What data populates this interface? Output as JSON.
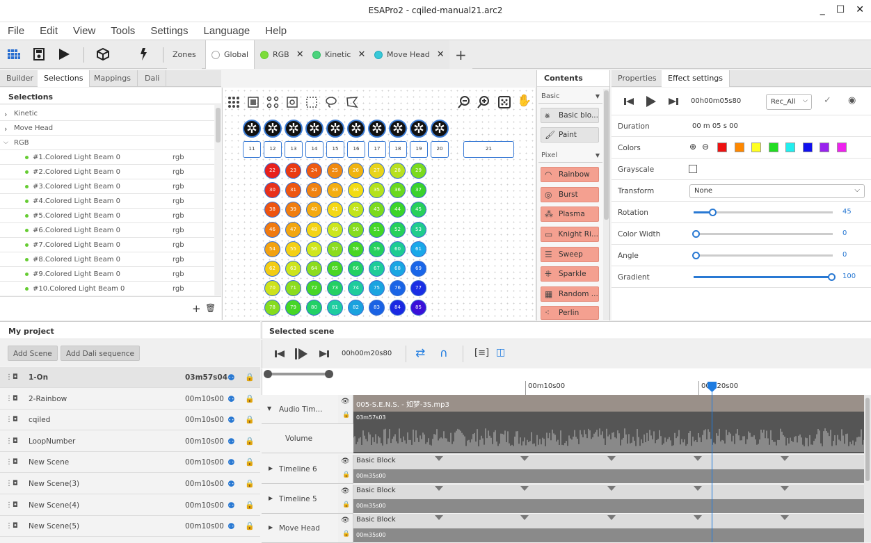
{
  "window": {
    "title": "ESAPro2 - cqiled-manual21.arc2"
  },
  "menu": [
    "File",
    "Edit",
    "View",
    "Tools",
    "Settings",
    "Language",
    "Help"
  ],
  "toolbar": {
    "zones_label": "Zones",
    "tabs": [
      {
        "label": "Global",
        "color": "#ffffff"
      },
      {
        "label": "RGB",
        "color": "#7ddc3a"
      },
      {
        "label": "Kinetic",
        "color": "#4bd37c"
      },
      {
        "label": "Move Head",
        "color": "#38c9d8"
      }
    ]
  },
  "left_tabs": [
    "Builder",
    "Selections",
    "Mappings",
    "Dali"
  ],
  "selections": {
    "header": "Selections",
    "groups": [
      "Kinetic",
      "Move Head",
      "RGB"
    ],
    "items": [
      {
        "name": "#1.Colored Light Beam 0",
        "type": "rgb"
      },
      {
        "name": "#2.Colored Light Beam 0",
        "type": "rgb"
      },
      {
        "name": "#3.Colored Light Beam 0",
        "type": "rgb"
      },
      {
        "name": "#4.Colored Light Beam 0",
        "type": "rgb"
      },
      {
        "name": "#5.Colored Light Beam 0",
        "type": "rgb"
      },
      {
        "name": "#6.Colored Light Beam 0",
        "type": "rgb"
      },
      {
        "name": "#7.Colored Light Beam 0",
        "type": "rgb"
      },
      {
        "name": "#8.Colored Light Beam 0",
        "type": "rgb"
      },
      {
        "name": "#9.Colored Light Beam 0",
        "type": "rgb"
      },
      {
        "name": "#10.Colored Light Beam 0",
        "type": "rgb"
      }
    ]
  },
  "canvas": {
    "square_labels": [
      "11",
      "12",
      "13",
      "14",
      "15",
      "16",
      "17",
      "18",
      "19",
      "20",
      "21"
    ],
    "led_rows": [
      {
        "labels": [
          "22",
          "23",
          "24",
          "25",
          "26",
          "27",
          "28",
          "29"
        ],
        "colors": [
          "#e8201c",
          "#ea3a12",
          "#ee5a10",
          "#f08a10",
          "#f0b410",
          "#e8d41a",
          "#b8e020",
          "#7ada1e"
        ]
      },
      {
        "labels": [
          "30",
          "31",
          "32",
          "33",
          "34",
          "35",
          "36",
          "37"
        ],
        "colors": [
          "#e8301a",
          "#ee5610",
          "#f08210",
          "#f4ae10",
          "#f2dc14",
          "#b4e21c",
          "#6ad81e",
          "#3ad22c"
        ]
      },
      {
        "labels": [
          "38",
          "39",
          "40",
          "41",
          "42",
          "43",
          "44",
          "45"
        ],
        "colors": [
          "#ee5410",
          "#f07e10",
          "#f4aa10",
          "#f4d816",
          "#c2e41c",
          "#7cda1e",
          "#3cd42a",
          "#28d05a"
        ]
      },
      {
        "labels": [
          "46",
          "47",
          "48",
          "49",
          "50",
          "51",
          "52",
          "53"
        ],
        "colors": [
          "#f07a10",
          "#f2a610",
          "#f4d414",
          "#cce61c",
          "#86dc1e",
          "#44d626",
          "#26d05a",
          "#20cc8c"
        ]
      },
      {
        "labels": [
          "54",
          "55",
          "56",
          "57",
          "58",
          "59",
          "60",
          "61"
        ],
        "colors": [
          "#f2a210",
          "#f4d014",
          "#d0e61c",
          "#8cdc1e",
          "#48d624",
          "#26d05e",
          "#1ecc92",
          "#1aa8e8"
        ]
      },
      {
        "labels": [
          "62",
          "63",
          "64",
          "65",
          "66",
          "67",
          "68",
          "69"
        ],
        "colors": [
          "#f2cc14",
          "#cde41c",
          "#8cdc1e",
          "#4ad624",
          "#24d062",
          "#1ecc98",
          "#1aa6e2",
          "#1a66e8"
        ]
      },
      {
        "labels": [
          "70",
          "71",
          "72",
          "73",
          "74",
          "75",
          "76",
          "77"
        ],
        "colors": [
          "#cde21c",
          "#8cdc1e",
          "#48d626",
          "#24d064",
          "#1ecc9c",
          "#1aa4e0",
          "#1a64e6",
          "#1a2ee4"
        ]
      },
      {
        "labels": [
          "78",
          "79",
          "80",
          "81",
          "82",
          "83",
          "84",
          "85"
        ],
        "colors": [
          "#86dc1e",
          "#46d626",
          "#22d066",
          "#1ecca0",
          "#1aa2de",
          "#1a62e4",
          "#1a28e2",
          "#3a10d8"
        ]
      }
    ]
  },
  "contents": {
    "header": "Contents",
    "group_basic": "Basic",
    "basic_items": [
      {
        "label": "Basic blo...",
        "icon": "basic-block-icon"
      },
      {
        "label": "Paint",
        "icon": "paint-brush-icon"
      }
    ],
    "group_pixel": "Pixel",
    "pixel_items": [
      {
        "label": "Rainbow",
        "icon": "rainbow-icon"
      },
      {
        "label": "Burst",
        "icon": "burst-icon"
      },
      {
        "label": "Plasma",
        "icon": "plasma-icon"
      },
      {
        "label": "Knight Ri...",
        "icon": "knight-rider-icon"
      },
      {
        "label": "Sweep",
        "icon": "sweep-icon"
      },
      {
        "label": "Sparkle",
        "icon": "sparkle-icon"
      },
      {
        "label": "Random ...",
        "icon": "random-icon"
      },
      {
        "label": "Perlin",
        "icon": "perlin-icon"
      }
    ]
  },
  "right_tabs": [
    "Properties",
    "Effect settings"
  ],
  "effect": {
    "time": "00h00m05s80",
    "record_select": "Rec_All",
    "duration_label": "Duration",
    "duration_value": "00  m  05  s  00",
    "colors_label": "Colors",
    "colors": [
      "#ee1111",
      "#ff8800",
      "#ffff22",
      "#22dd22",
      "#22eeee",
      "#1111ee",
      "#9922ee",
      "#ee22ee"
    ],
    "grayscale_label": "Grayscale",
    "transform_label": "Transform",
    "transform_value": "None",
    "sliders": [
      {
        "label": "Rotation",
        "value": "45",
        "fraction": 0.125
      },
      {
        "label": "Color Width",
        "value": "0",
        "fraction": 0
      },
      {
        "label": "Angle",
        "value": "0",
        "fraction": 0
      },
      {
        "label": "Gradient",
        "value": "100",
        "fraction": 1
      }
    ]
  },
  "project": {
    "header": "My project",
    "add_scene": "Add Scene",
    "add_dali": "Add Dali sequence",
    "scenes": [
      {
        "name": "1-On",
        "time": "03m57s04"
      },
      {
        "name": "2-Rainbow",
        "time": "00m10s00"
      },
      {
        "name": "cqiled",
        "time": "00m10s00"
      },
      {
        "name": "LoopNumber",
        "time": "00m10s00"
      },
      {
        "name": "New Scene",
        "time": "00m10s00"
      },
      {
        "name": "New Scene(3)",
        "time": "00m10s00"
      },
      {
        "name": "New Scene(4)",
        "time": "00m10s00"
      },
      {
        "name": "New Scene(5)",
        "time": "00m10s00"
      }
    ]
  },
  "scene": {
    "header": "Selected scene",
    "time": "00h00m20s80",
    "ruler_labels": [
      "00m10s00",
      "00m20s00"
    ],
    "audio": {
      "label": "Audio Tim...",
      "file": "005-S.E.N.S. - 如梦-3S.mp3",
      "duration": "03m57s03",
      "volume_label": "Volume"
    },
    "tracks": [
      {
        "label": "Timeline 6",
        "block": "Basic Block",
        "duration": "00m35s00"
      },
      {
        "label": "Timeline 5",
        "block": "Basic Block",
        "duration": "00m35s00"
      },
      {
        "label": "Move Head",
        "block": "Basic Block",
        "duration": "00m35s00"
      }
    ]
  }
}
